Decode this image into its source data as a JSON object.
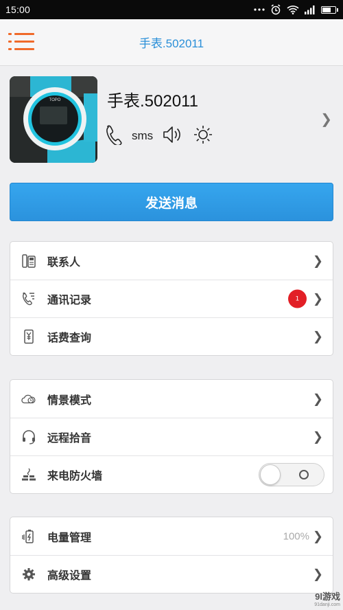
{
  "status_bar": {
    "time": "15:00"
  },
  "header": {
    "title": "手表.502011"
  },
  "device": {
    "name": "手表.502011",
    "photo_text": "TOPO",
    "sms_label": "sms"
  },
  "send_button": {
    "label": "发送消息"
  },
  "group1": {
    "items": [
      {
        "label": "联系人",
        "icon": "phone-book-icon"
      },
      {
        "label": "通讯记录",
        "icon": "call-log-icon",
        "badge": "1"
      },
      {
        "label": "话费查询",
        "icon": "bill-icon"
      }
    ]
  },
  "group2": {
    "items": [
      {
        "label": "情景模式",
        "icon": "scene-mode-icon"
      },
      {
        "label": "远程拾音",
        "icon": "headset-icon"
      },
      {
        "label": "来电防火墙",
        "icon": "firewall-icon",
        "toggle": "off"
      }
    ]
  },
  "group3": {
    "items": [
      {
        "label": "电量管理",
        "icon": "battery-charge-icon",
        "value": "100%"
      },
      {
        "label": "高级设置",
        "icon": "gear-icon"
      }
    ]
  },
  "watermark": {
    "main": "9l游戏",
    "sub": "91danji.com"
  },
  "colors": {
    "accent_blue": "#2b92dd",
    "menu_orange": "#f06a2a",
    "badge_red": "#e21f26"
  }
}
